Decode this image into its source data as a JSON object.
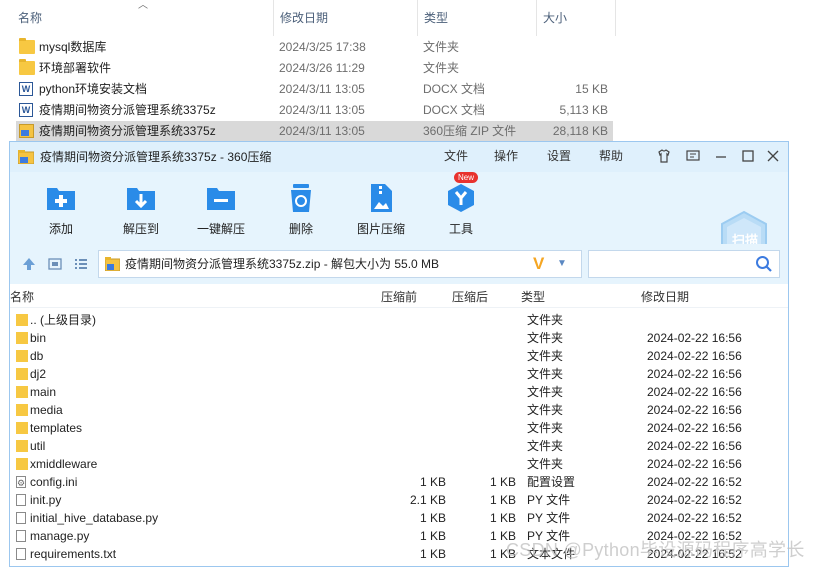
{
  "explorer": {
    "headers": {
      "name": "名称",
      "modified": "修改日期",
      "type": "类型",
      "size": "大小"
    },
    "rows": [
      {
        "icon": "folder-icon",
        "name": "mysql数据库",
        "modified": "2024/3/25 17:38",
        "type": "文件夹",
        "size": ""
      },
      {
        "icon": "folder-icon",
        "name": "环境部署软件",
        "modified": "2024/3/26 11:29",
        "type": "文件夹",
        "size": ""
      },
      {
        "icon": "docx-icon",
        "name": "python环境安装文档",
        "modified": "2024/3/11 13:05",
        "type": "DOCX 文档",
        "size": "15 KB"
      },
      {
        "icon": "docx-icon",
        "name": "疫情期间物资分派管理系统3375z",
        "modified": "2024/3/11 13:05",
        "type": "DOCX 文档",
        "size": "5,113 KB"
      },
      {
        "icon": "zip-icon",
        "name": "疫情期间物资分派管理系统3375z",
        "modified": "2024/3/11 13:05",
        "type": "360压缩 ZIP 文件",
        "size": "28,118 KB"
      }
    ]
  },
  "zipwin": {
    "title": "疫情期间物资分派管理系统3375z - 360压缩",
    "menus": [
      "文件",
      "操作",
      "设置",
      "帮助"
    ],
    "tools": [
      {
        "label": "添加",
        "icon": "add-icon"
      },
      {
        "label": "解压到",
        "icon": "extract-to-icon"
      },
      {
        "label": "一键解压",
        "icon": "one-click-extract-icon"
      },
      {
        "label": "删除",
        "icon": "delete-icon"
      },
      {
        "label": "图片压缩",
        "icon": "image-compress-icon"
      },
      {
        "label": "工具",
        "icon": "tools-icon"
      }
    ],
    "new_badge": "New",
    "scan_label": "扫描",
    "address": "疫情期间物资分派管理系统3375z.zip - 解包大小为 55.0 MB",
    "search_placeholder": "",
    "columns": {
      "name": "名称",
      "compressed_before": "压缩前",
      "compressed_after": "压缩后",
      "type": "类型",
      "modified": "修改日期"
    },
    "items": [
      {
        "icon": "folder",
        "name": ".. (上级目录)",
        "before": "",
        "after": "",
        "type": "文件夹",
        "modified": ""
      },
      {
        "icon": "folder",
        "name": "bin",
        "before": "",
        "after": "",
        "type": "文件夹",
        "modified": "2024-02-22 16:56"
      },
      {
        "icon": "folder",
        "name": "db",
        "before": "",
        "after": "",
        "type": "文件夹",
        "modified": "2024-02-22 16:56"
      },
      {
        "icon": "folder",
        "name": "dj2",
        "before": "",
        "after": "",
        "type": "文件夹",
        "modified": "2024-02-22 16:56"
      },
      {
        "icon": "folder",
        "name": "main",
        "before": "",
        "after": "",
        "type": "文件夹",
        "modified": "2024-02-22 16:56"
      },
      {
        "icon": "folder",
        "name": "media",
        "before": "",
        "after": "",
        "type": "文件夹",
        "modified": "2024-02-22 16:56"
      },
      {
        "icon": "folder",
        "name": "templates",
        "before": "",
        "after": "",
        "type": "文件夹",
        "modified": "2024-02-22 16:56"
      },
      {
        "icon": "folder",
        "name": "util",
        "before": "",
        "after": "",
        "type": "文件夹",
        "modified": "2024-02-22 16:56"
      },
      {
        "icon": "folder",
        "name": "xmiddleware",
        "before": "",
        "after": "",
        "type": "文件夹",
        "modified": "2024-02-22 16:56"
      },
      {
        "icon": "config",
        "name": "config.ini",
        "before": "1 KB",
        "after": "1 KB",
        "type": "配置设置",
        "modified": "2024-02-22 16:52"
      },
      {
        "icon": "file",
        "name": "init.py",
        "before": "2.1 KB",
        "after": "1 KB",
        "type": "PY 文件",
        "modified": "2024-02-22 16:52"
      },
      {
        "icon": "file",
        "name": "initial_hive_database.py",
        "before": "1 KB",
        "after": "1 KB",
        "type": "PY 文件",
        "modified": "2024-02-22 16:52"
      },
      {
        "icon": "file",
        "name": "manage.py",
        "before": "1 KB",
        "after": "1 KB",
        "type": "PY 文件",
        "modified": "2024-02-22 16:52"
      },
      {
        "icon": "file",
        "name": "requirements.txt",
        "before": "1 KB",
        "after": "1 KB",
        "type": "文本文件",
        "modified": "2024-02-22 16:52"
      }
    ]
  },
  "watermark": "CSDN @Python毕设源码程序高学长",
  "colors": {
    "titlebar": "#dff0fc",
    "toolbar": "#e6f4fd",
    "accent": "#2a8be8",
    "folder": "#f7c842"
  }
}
